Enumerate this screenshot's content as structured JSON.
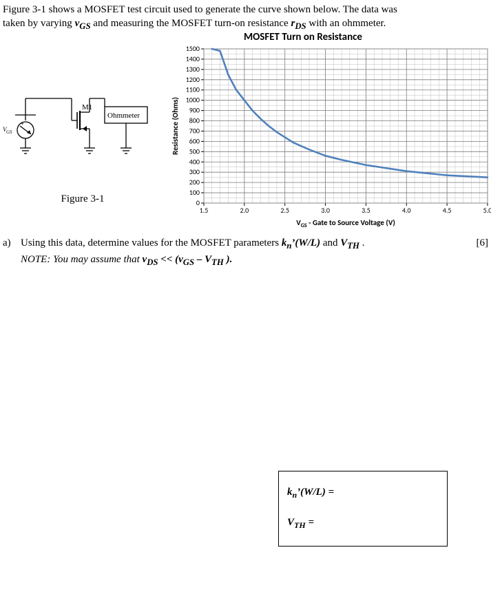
{
  "intro": {
    "line1_a": "Figure 3-1 shows a MOSFET test circuit used to generate the curve shown below.  The data was",
    "line2_a": "taken by varying ",
    "line2_b": "v",
    "line2_c": "GS",
    "line2_d": " and measuring the MOSFET turn-on resistance ",
    "line2_e": "r",
    "line2_f": "DS",
    "line2_g": " with an ohmmeter."
  },
  "circuit": {
    "vgs": "GS",
    "m1": "M1",
    "ohmmeter": "Ohmmeter",
    "caption": "Figure 3-1"
  },
  "chart_data": {
    "type": "line",
    "title": "MOSFET Turn on Resistance",
    "xlabel": "V_GS - Gate to Source Voltage (V)",
    "ylabel": "Resistance (Ohms)",
    "xlim": [
      1.5,
      5.0
    ],
    "ylim": [
      0,
      1500
    ],
    "xticks": [
      1.5,
      2.0,
      2.5,
      3.0,
      3.5,
      4.0,
      4.5,
      5.0
    ],
    "yticks": [
      0,
      100,
      200,
      300,
      400,
      500,
      600,
      700,
      800,
      900,
      1000,
      1100,
      1200,
      1300,
      1400,
      1500
    ],
    "x": [
      1.6,
      1.7,
      1.8,
      1.9,
      2.0,
      2.1,
      2.2,
      2.3,
      2.4,
      2.5,
      2.6,
      2.8,
      3.0,
      3.2,
      3.5,
      4.0,
      4.5,
      5.0
    ],
    "y": [
      1500,
      1480,
      1250,
      1100,
      1000,
      900,
      820,
      750,
      690,
      640,
      590,
      520,
      460,
      420,
      370,
      310,
      270,
      250
    ]
  },
  "question": {
    "label": "a)",
    "text_a": "Using this data, determine values for the MOSFET parameters ",
    "kn": "k",
    "knsub": "n",
    "knprime": "’(W/L)",
    "text_b": " and ",
    "vth": "V",
    "vthsub": "TH",
    "period": " .",
    "note_a": "NOTE:  You may assume that ",
    "vds": "v",
    "vdssub": "DS",
    "note_b": " << (",
    "vgs": "v",
    "vgssub": "GS",
    "note_c": " – ",
    "note_vth": "V",
    "note_vthsub": "TH",
    "note_d": " ).",
    "marks": "[6]"
  },
  "answers": {
    "kn_line": "kₙ’(W/L) =",
    "vth_line": "V_TH ="
  }
}
